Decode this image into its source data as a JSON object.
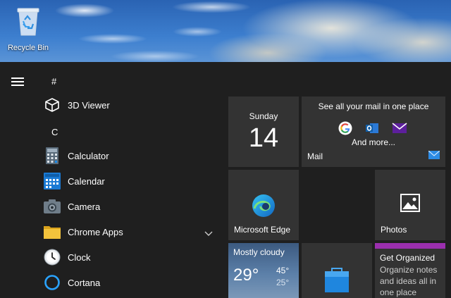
{
  "desktop": {
    "recycle_bin_label": "Recycle Bin"
  },
  "start_menu": {
    "sections": [
      {
        "header": "#",
        "apps": [
          {
            "label": "3D Viewer",
            "icon": "cube-icon"
          }
        ]
      },
      {
        "header": "C",
        "apps": [
          {
            "label": "Calculator",
            "icon": "calculator-icon"
          },
          {
            "label": "Calendar",
            "icon": "calendar-icon"
          },
          {
            "label": "Camera",
            "icon": "camera-icon"
          },
          {
            "label": "Chrome Apps",
            "icon": "folder-icon",
            "expandable": true
          },
          {
            "label": "Clock",
            "icon": "clock-icon"
          },
          {
            "label": "Cortana",
            "icon": "cortana-icon"
          }
        ]
      }
    ],
    "tiles": {
      "calendar": {
        "day": "Sunday",
        "date": "14"
      },
      "mail": {
        "headline": "See all your mail in one place",
        "more": "And more...",
        "label": "Mail"
      },
      "edge": {
        "label": "Microsoft Edge"
      },
      "photos": {
        "label": "Photos"
      },
      "weather": {
        "condition": "Mostly cloudy",
        "temp": "29°",
        "high": "45°",
        "low": "25°"
      },
      "get_organized": {
        "title": "Get Organized",
        "body": "Organize notes and ideas all in one place"
      }
    }
  },
  "colors": {
    "start_bg": "#1f1f1f",
    "tile_bg": "#333333",
    "accent_purple": "#9b2fae",
    "accent_blue": "#0078d7"
  }
}
